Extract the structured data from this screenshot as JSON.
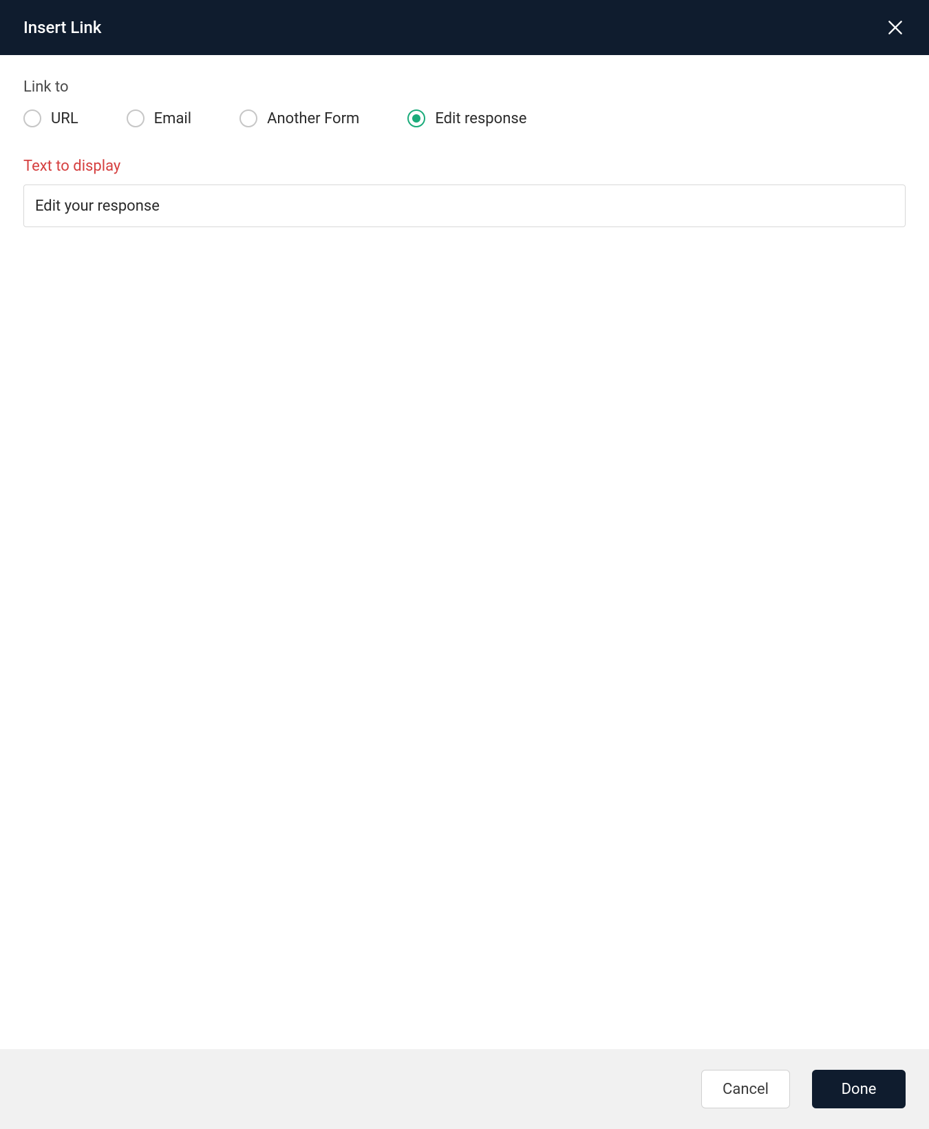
{
  "header": {
    "title": "Insert Link"
  },
  "linkTo": {
    "label": "Link to",
    "options": {
      "url": "URL",
      "email": "Email",
      "anotherForm": "Another Form",
      "editResponse": "Edit response"
    },
    "selected": "editResponse"
  },
  "textToDisplay": {
    "label": "Text to display",
    "value": "Edit your response"
  },
  "footer": {
    "cancel": "Cancel",
    "done": "Done"
  }
}
